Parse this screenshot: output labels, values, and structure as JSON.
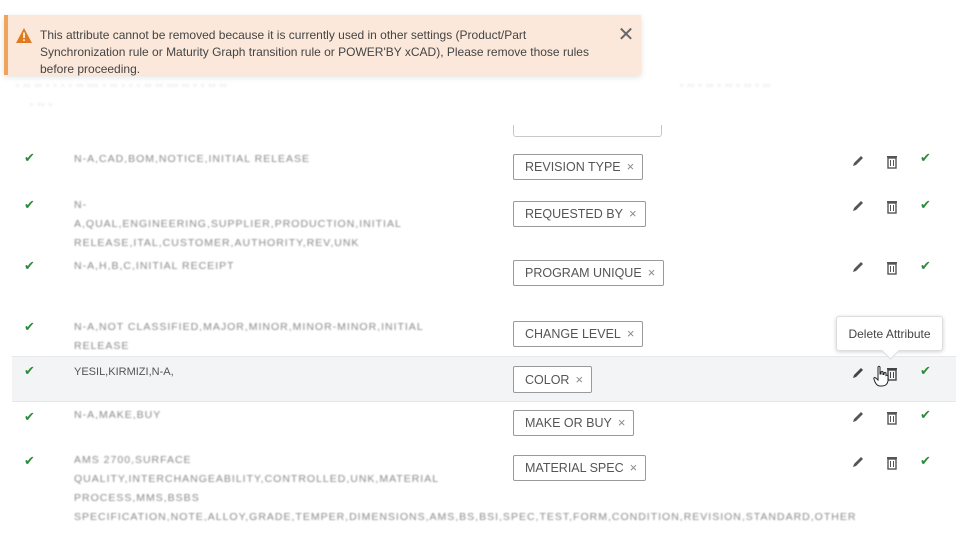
{
  "alert": {
    "message": "This attribute cannot be removed because it is currently used in other settings (Product/Part Synchronization rule or Maturity Graph transition rule or POWER'BY xCAD), Please remove those rules before proceeding.",
    "icon": "warning-icon",
    "close_icon": "close-icon",
    "close_glyph": "✕"
  },
  "tooltip": {
    "label": "Delete Attribute"
  },
  "rows": [
    {
      "values": "N-A,CAD,BOM,NOTICE,INITIAL RELEASE",
      "tag": "REVISION TYPE"
    },
    {
      "values": "N-A,QUAL,ENGINEERING,SUPPLIER,PRODUCTION,INITIAL RELEASE,ITAL,CUSTOMER,AUTHORITY,REV,UNK",
      "tag": "REQUESTED BY"
    },
    {
      "values": "N-A,H,B,C,INITIAL RECEIPT",
      "tag": "PROGRAM UNIQUE"
    },
    {
      "values": "N-A,NOT CLASSIFIED,MAJOR,MINOR,MINOR-MINOR,INITIAL RELEASE",
      "tag": "CHANGE LEVEL"
    },
    {
      "values": "YESIL,KIRMIZI,N-A,",
      "tag": "COLOR"
    },
    {
      "values": "N-A,MAKE,BUY",
      "tag": "MAKE OR BUY"
    },
    {
      "values": "AMS 2700,SURFACE QUALITY,INTERCHANGEABILITY,CONTROLLED,UNK,MATERIAL PROCESS,MMS,BSBS SPECIFICATION,NOTE,ALLOY,GRADE,TEMPER,DIMENSIONS,AMS,BS,BSI,SPEC,TEST,FORM,CONDITION,REVISION,STANDARD,OTHER",
      "tag": "MATERIAL SPEC"
    }
  ],
  "remove_glyph": "×",
  "check_glyph": "✔",
  "colors": {
    "check": "#2e8b3d",
    "alert_bg": "#fbe8da",
    "alert_accent": "#f0a35a"
  }
}
